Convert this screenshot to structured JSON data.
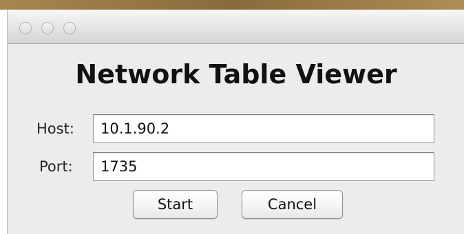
{
  "window": {
    "title": ""
  },
  "heading": "Network Table Viewer",
  "form": {
    "host_label": "Host:",
    "host_value": "10.1.90.2",
    "port_label": "Port:",
    "port_value": "1735"
  },
  "buttons": {
    "start_label": "Start",
    "cancel_label": "Cancel"
  },
  "icons": {
    "close": "close-dot-icon",
    "minimize": "minimize-dot-icon",
    "zoom": "zoom-dot-icon"
  },
  "colors": {
    "window_bg": "#ececec",
    "desktop": "#8a6a3c"
  }
}
